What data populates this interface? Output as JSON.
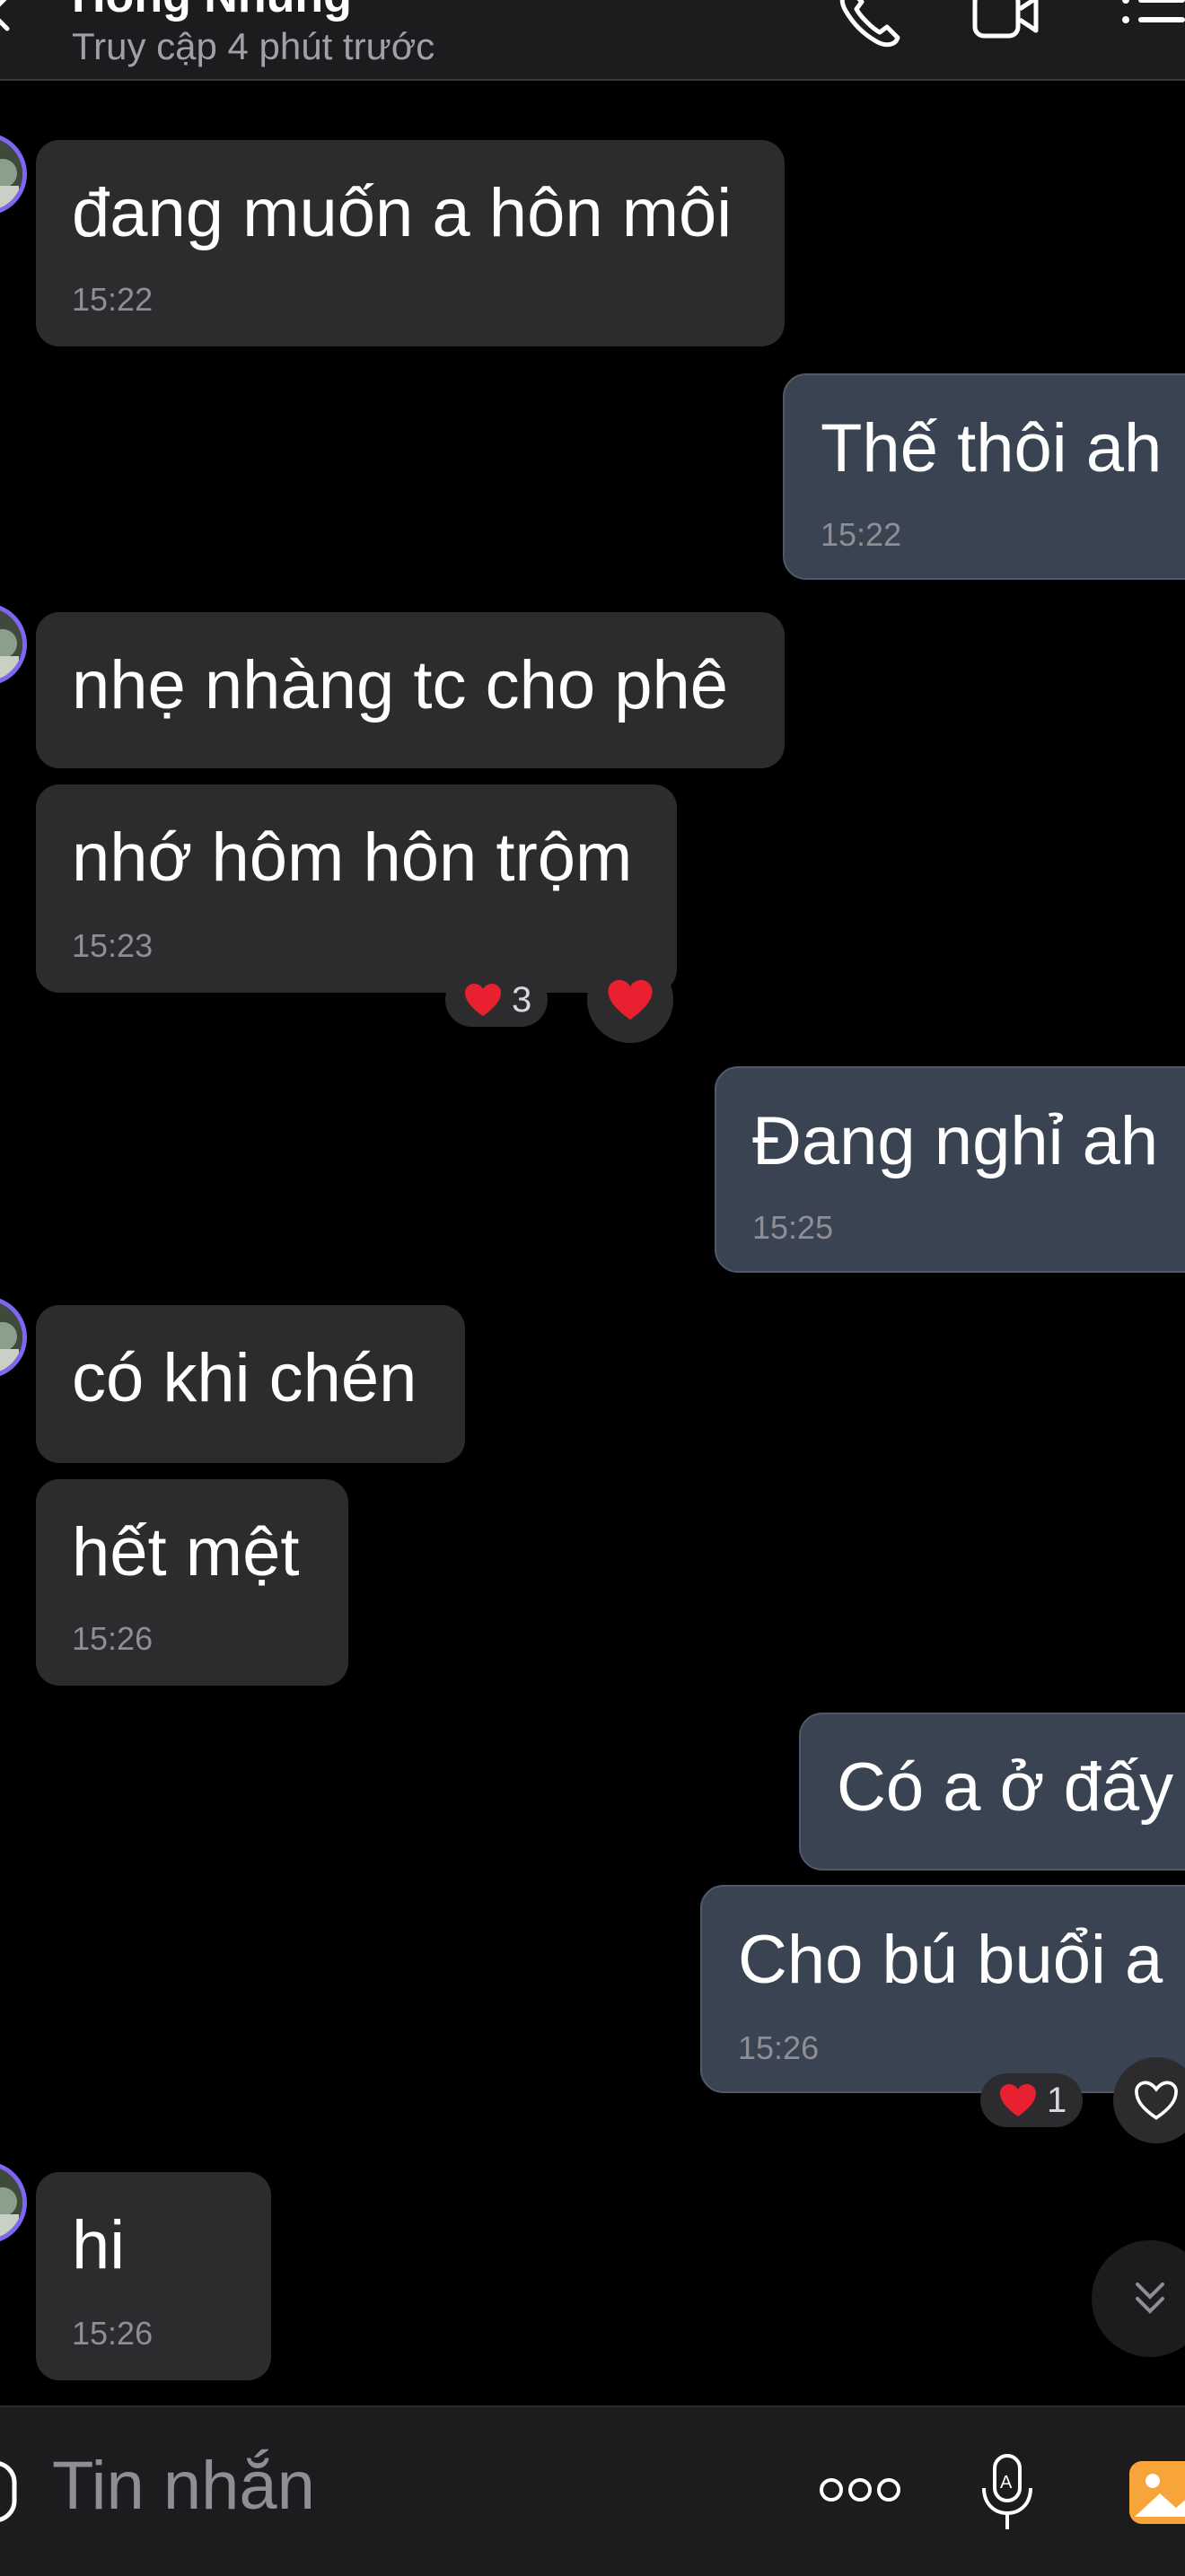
{
  "header": {
    "contact_name": "Hồng Nhung",
    "status": "Truy cập 4 phút trước"
  },
  "messages": [
    {
      "text": "đang muốn a hôn môi",
      "time": "15:22"
    },
    {
      "text": "Thế thôi ah",
      "time": "15:22"
    },
    {
      "text": "nhẹ nhàng tc cho phê"
    },
    {
      "text": "nhớ hôm hôn trộm",
      "time": "15:23",
      "reaction_count": "3"
    },
    {
      "text": "Đang nghỉ ah",
      "time": "15:25"
    },
    {
      "text": "có khi chén"
    },
    {
      "text": "hết mệt",
      "time": "15:26"
    },
    {
      "text": "Có a ở đấy"
    },
    {
      "text": "Cho bú buổi a",
      "time": "15:26",
      "reaction_count": "1"
    },
    {
      "text": "hi",
      "time": "15:26"
    }
  ],
  "composer": {
    "placeholder": "Tin nhắn"
  },
  "colors": {
    "background": "#000000",
    "incoming_bubble": "#2c2c2e",
    "outgoing_bubble": "#3a4351",
    "heart": "#e8202f",
    "avatar_ring": "#7f66f2",
    "image_button": "#f7a43a"
  },
  "icons": [
    "back-icon",
    "phone-icon",
    "video-call-icon",
    "list-menu-icon",
    "heart-icon",
    "heart-outline-icon",
    "double-chevron-down-icon",
    "sticker-icon",
    "more-dots-icon",
    "voice-mic-icon",
    "image-icon"
  ]
}
